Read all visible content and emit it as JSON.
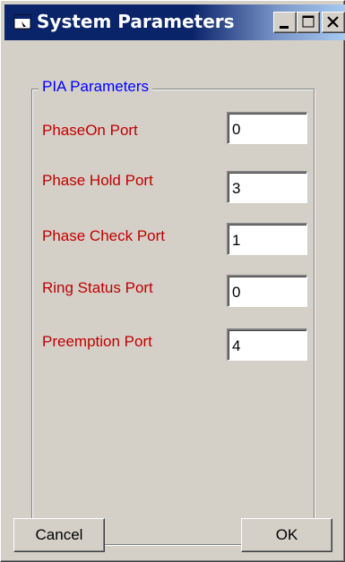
{
  "window": {
    "title": "System Parameters",
    "title_icon": "app-window-icon",
    "controls": [
      "minimize-icon",
      "maximize-icon",
      "close-icon"
    ]
  },
  "group": {
    "legend": "PIA Parameters"
  },
  "fields": [
    {
      "label": "PhaseOn Port",
      "value": "0"
    },
    {
      "label": "Phase Hold Port",
      "value": "3"
    },
    {
      "label": "Phase Check Port",
      "value": "1"
    },
    {
      "label": "Ring Status Port",
      "value": "0"
    },
    {
      "label": "Preemption Port",
      "value": "4"
    }
  ],
  "buttons": {
    "cancel": "Cancel",
    "ok": "OK"
  },
  "colors": {
    "title_bar": "#0a246a",
    "label_text": "#c00000",
    "legend_text": "#0000ff",
    "face": "#d4d0c8"
  }
}
